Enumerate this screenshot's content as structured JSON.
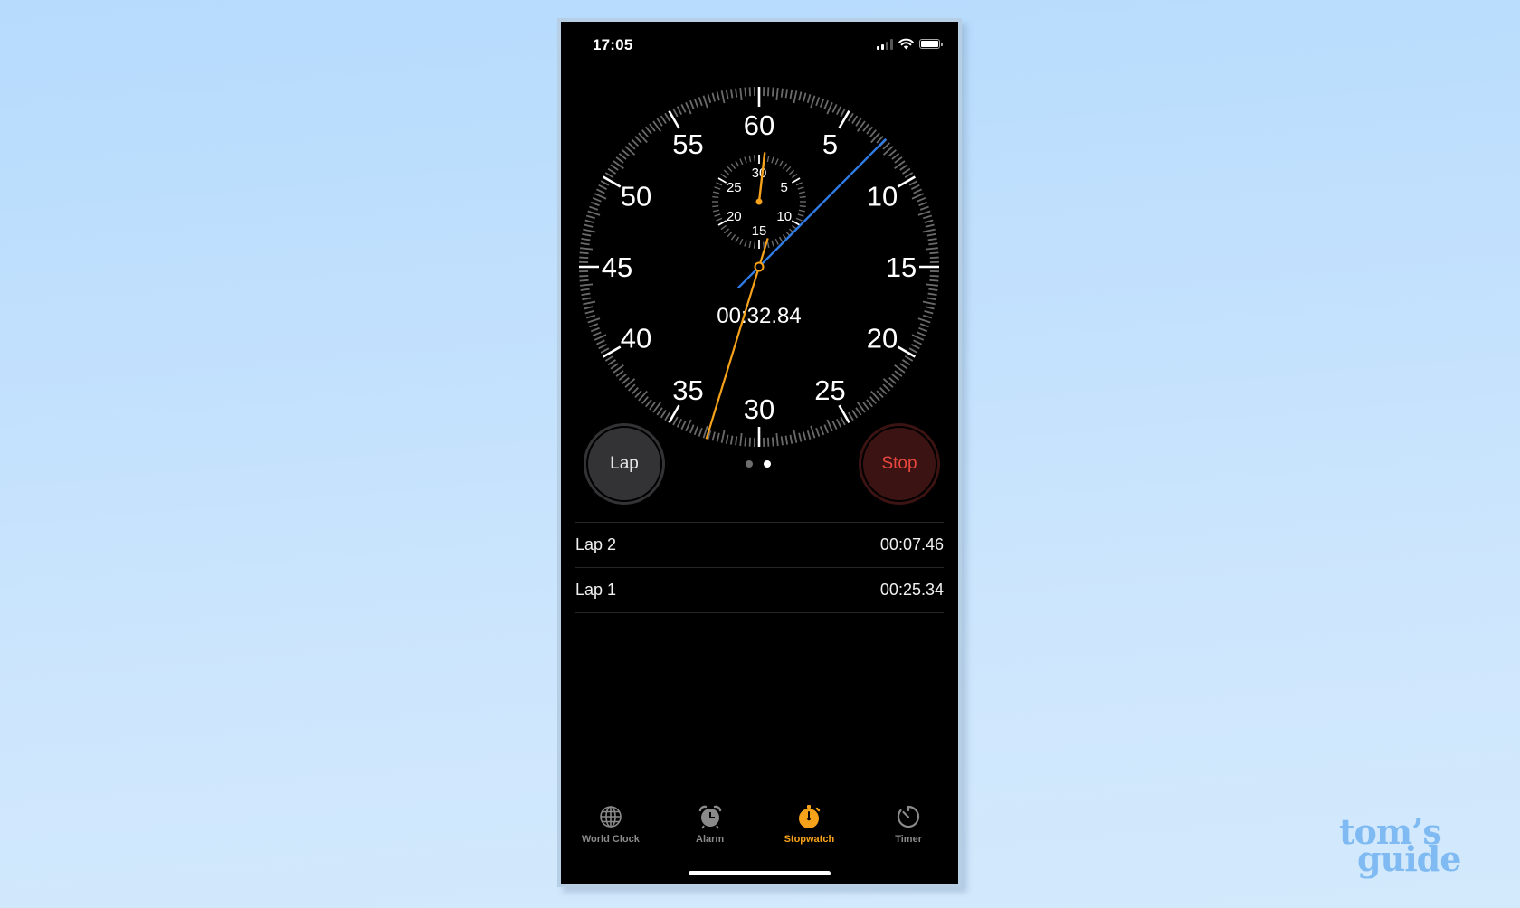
{
  "status_bar": {
    "time": "17:05",
    "signal_bars_filled": 2,
    "signal_bars_total": 4,
    "icons": [
      "signal-icon",
      "wifi-icon",
      "battery-icon"
    ]
  },
  "stopwatch": {
    "elapsed_display": "00:32.84",
    "elapsed_seconds": 32.84,
    "current_lap_seconds": 7.46,
    "elapsed_minutes": 0.547,
    "outer_dial_labels": [
      "60",
      "5",
      "10",
      "15",
      "20",
      "25",
      "30",
      "35",
      "40",
      "45",
      "50",
      "55"
    ],
    "inner_dial_labels": [
      "30",
      "5",
      "10",
      "15",
      "20",
      "25"
    ],
    "colors": {
      "main_hand": "#f7a21b",
      "lap_hand": "#2f7ce6",
      "major_tick": "#ffffff",
      "minor_tick": "#6a6a6a"
    }
  },
  "controls": {
    "lap_label": "Lap",
    "stop_label": "Stop",
    "page_count": 2,
    "active_page": 2
  },
  "laps": [
    {
      "label": "Lap 2",
      "time": "00:07.46"
    },
    {
      "label": "Lap 1",
      "time": "00:25.34"
    }
  ],
  "tabbar": {
    "active": "Stopwatch",
    "accent_color": "#f7a21b",
    "tabs": [
      {
        "label": "World Clock",
        "icon": "globe-icon"
      },
      {
        "label": "Alarm",
        "icon": "alarm-clock-icon"
      },
      {
        "label": "Stopwatch",
        "icon": "stopwatch-icon"
      },
      {
        "label": "Timer",
        "icon": "timer-icon"
      }
    ]
  },
  "watermark": {
    "line1": "tom’s",
    "line2": "guide"
  }
}
